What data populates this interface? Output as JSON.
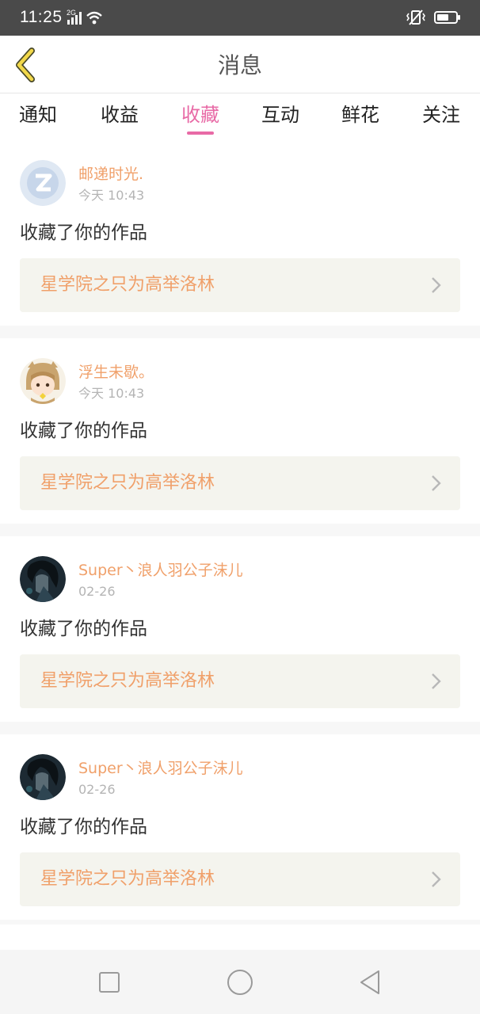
{
  "status_bar": {
    "time": "11:25",
    "network": "2G",
    "icons": [
      "signal-icon",
      "wifi-icon",
      "vibrate-icon",
      "battery-icon"
    ]
  },
  "header": {
    "title": "消息",
    "back_icon": "chevron-left-icon"
  },
  "tabs": [
    {
      "label": "通知",
      "active": false
    },
    {
      "label": "收益",
      "active": false
    },
    {
      "label": "收藏",
      "active": true
    },
    {
      "label": "互动",
      "active": false
    },
    {
      "label": "鲜花",
      "active": false
    },
    {
      "label": "关注",
      "active": false
    }
  ],
  "messages": [
    {
      "user": "邮递时光.",
      "time": "今天 10:43",
      "action": "收藏了你的作品",
      "work": "星学院之只为高举洛林",
      "avatar": "qq-avatar"
    },
    {
      "user": "浮生未歇。",
      "time": "今天 10:43",
      "action": "收藏了你的作品",
      "work": "星学院之只为高举洛林",
      "avatar": "cartoon-girl-avatar"
    },
    {
      "user": "Super丶浪人羽公子沫儿",
      "time": "02-26",
      "action": "收藏了你的作品",
      "work": "星学院之只为高举洛林",
      "avatar": "dark-anime-avatar"
    },
    {
      "user": "Super丶浪人羽公子沫儿",
      "time": "02-26",
      "action": "收藏了你的作品",
      "work": "星学院之只为高举洛林",
      "avatar": "dark-anime-avatar"
    }
  ],
  "nav_bar": {
    "buttons": [
      "recent-apps-icon",
      "home-icon",
      "back-triangle-icon"
    ]
  },
  "colors": {
    "accent": "#e86aa6",
    "name_orange": "#f0a06a",
    "back_arrow_yellow": "#f2d84a",
    "status_bar": "#4a4a4a"
  }
}
